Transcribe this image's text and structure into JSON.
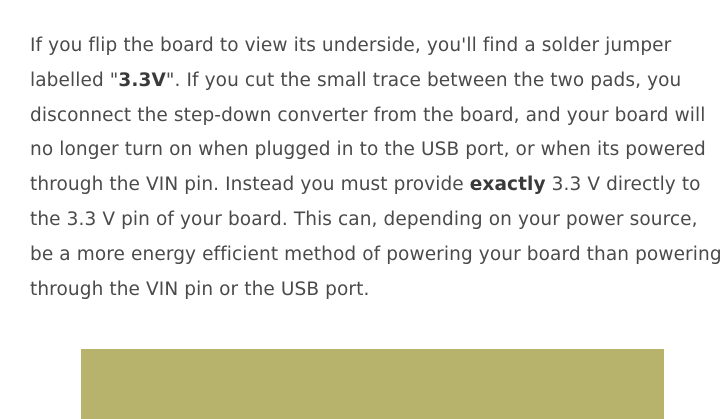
{
  "paragraph": {
    "seg1": "If you flip the board to view its underside, you'll find a solder jumper labelled \"",
    "bold1": "3.3V",
    "seg2": "\". If you cut the small trace between the two pads, you disconnect the step-down converter from the board, and your board will no longer turn on when plugged in to the USB port, or when its powered through the VIN pin. Instead you must provide ",
    "bold2": "exactly",
    "seg3": " 3.3 V directly to the 3.3 V pin of your board. This can, depending on your power source, be a more energy efficient method of powering your board than powering through the VIN pin or the USB port."
  },
  "image": {
    "fill_color": "#b8b36c"
  }
}
